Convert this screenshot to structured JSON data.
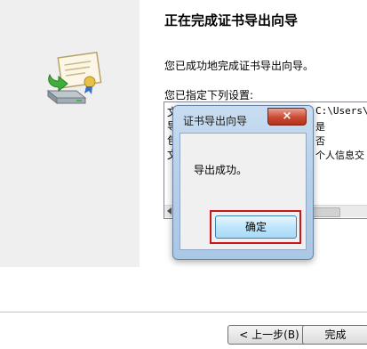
{
  "wizard": {
    "title": "正在完成证书导出向导",
    "success_text": "您已成功地完成证书导出向导。",
    "settings_label": "您已指定下列设置:",
    "settings_rows": [
      {
        "name": "文",
        "value": "C:\\Users\\C"
      },
      {
        "name": "导",
        "value": "是"
      },
      {
        "name": "包",
        "value": "否"
      },
      {
        "name": "文",
        "value": "个人信息交"
      }
    ],
    "back_label": "< 上一步(B)",
    "finish_label": "完成"
  },
  "dialog": {
    "title": "证书导出向导",
    "close_glyph": "×",
    "message": "导出成功。",
    "ok_label": "确定"
  },
  "colors": {
    "highlight": "#c8181c",
    "close_red": "#c94a34"
  }
}
